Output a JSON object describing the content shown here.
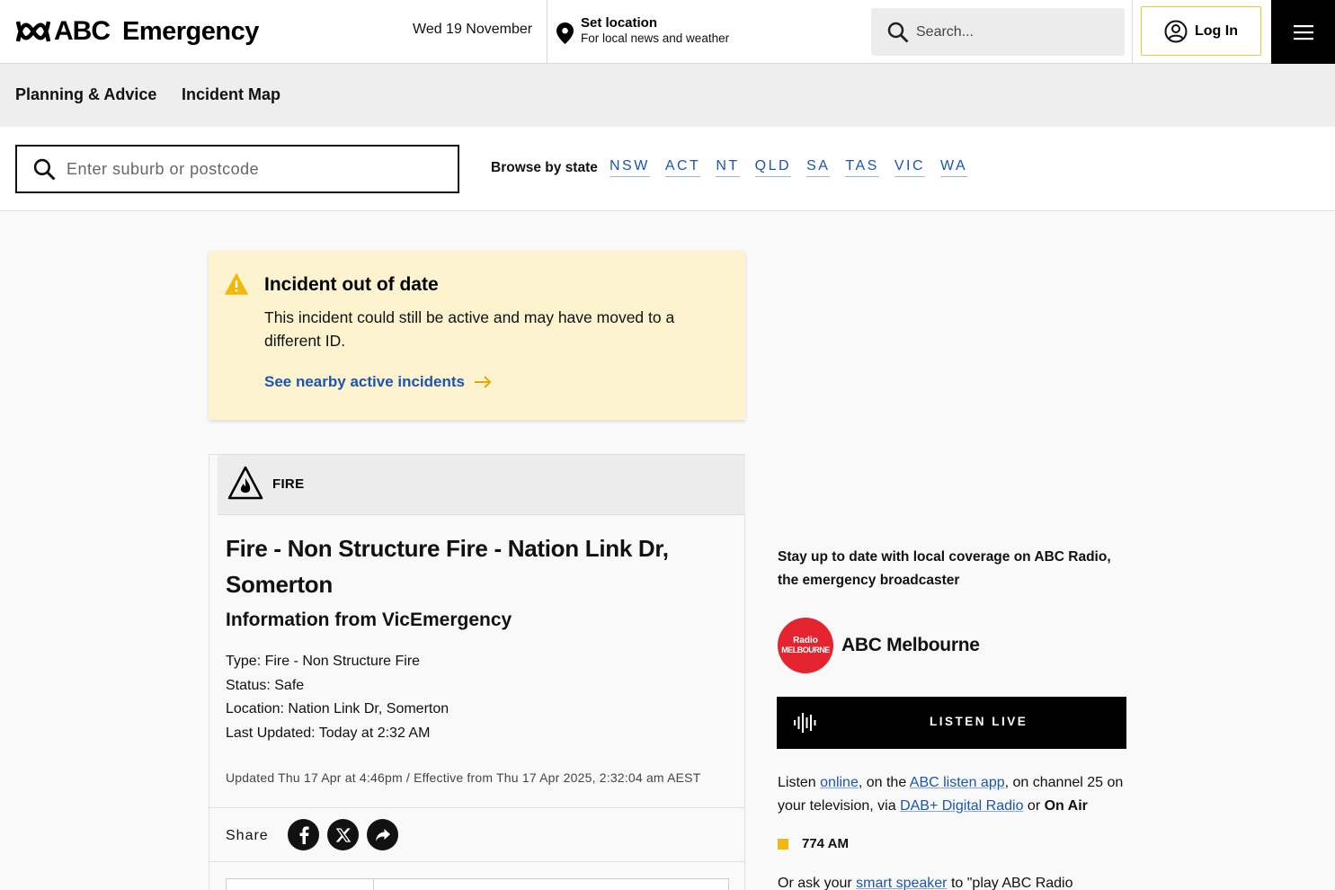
{
  "header": {
    "logo_text": "ABC",
    "section_title": "Emergency",
    "date": "Wed 19 November",
    "location_title": "Set location",
    "location_subtitle": "For local news and weather",
    "search_placeholder": "Search...",
    "login_label": "Log In"
  },
  "subnav": {
    "items": [
      "Planning & Advice",
      "Incident Map"
    ]
  },
  "search_row": {
    "suburb_placeholder": "Enter suburb or postcode",
    "browse_label": "Browse by state",
    "states": [
      "NSW",
      "ACT",
      "NT",
      "QLD",
      "SA",
      "TAS",
      "VIC",
      "WA"
    ]
  },
  "warning": {
    "title": "Incident out of date",
    "text": "This incident could still be active and may have moved to a different ID.",
    "link": "See nearby active incidents",
    "accent_color": "#f2b90c"
  },
  "incident": {
    "category": "FIRE",
    "title": "Fire - Non Structure Fire - Nation Link Dr, Somerton",
    "subtitle": "Information from VicEmergency",
    "type": "Type: Fire - Non Structure Fire",
    "status": "Status: Safe",
    "location": "Location: Nation Link Dr, Somerton",
    "last_updated": "Last Updated: Today at 2:32 AM",
    "updated_line": "Updated Thu 17 Apr at 4:46pm / Effective from Thu 17 Apr 2025, 2:32:04 am AEST",
    "share_label": "Share",
    "share_icons": [
      "facebook-icon",
      "x-icon",
      "share-icon"
    ]
  },
  "radio": {
    "intro": "Stay up to date with local coverage on ABC Radio, the emergency broadcaster",
    "logo_line1": "Radio",
    "logo_line2": "MELBOURNE",
    "station_name": "ABC Melbourne",
    "listen_label": "LISTEN LIVE",
    "para_listen": "Listen ",
    "link_online": "online",
    "para_onthe": ", on the ",
    "link_app": "ABC listen app",
    "para_channel": ", on channel 25 on your television, via ",
    "link_dab": "DAB+ Digital Radio",
    "para_or": " or ",
    "on_air": "On Air",
    "frequency": "774 AM",
    "para2_start": "Or ask your ",
    "link_speaker": "smart speaker",
    "para2_end": " to \"play ABC Radio",
    "brand_color": "#e4252f"
  }
}
